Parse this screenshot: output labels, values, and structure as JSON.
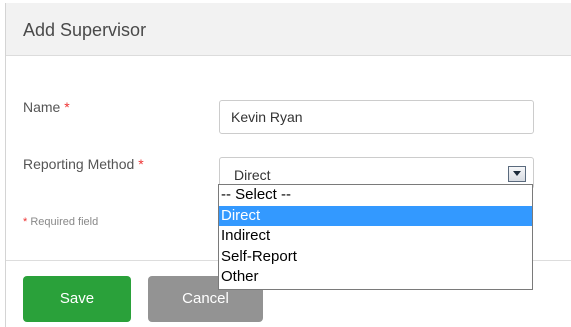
{
  "dialog": {
    "title": "Add Supervisor"
  },
  "form": {
    "name": {
      "label": "Name",
      "required_mark": "*",
      "value": "Kevin Ryan"
    },
    "reporting_method": {
      "label": "Reporting Method",
      "required_mark": "*",
      "selected": "Direct",
      "options": [
        "-- Select --",
        "Direct",
        "Indirect",
        "Self-Report",
        "Other"
      ],
      "highlighted_index": 1
    },
    "required_hint": {
      "mark": "*",
      "text": "Required field"
    }
  },
  "actions": {
    "save_label": "Save",
    "cancel_label": "Cancel"
  },
  "colors": {
    "save_button": "#2aa13a",
    "cancel_button": "#939393",
    "option_highlight": "#3399ff",
    "required_mark": "#e33333"
  },
  "icons": {
    "dropdown_arrow": "chevron-down-icon"
  }
}
